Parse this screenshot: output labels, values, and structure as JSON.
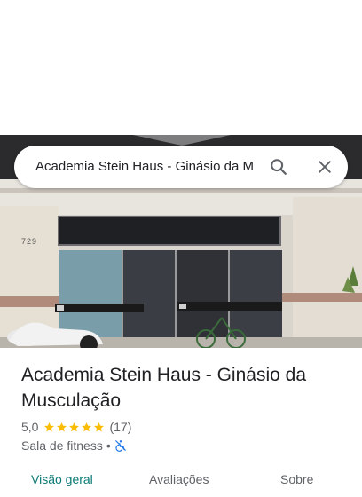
{
  "search": {
    "query": "Academia Stein Haus - Ginásio da M"
  },
  "photo": {
    "building_number": "729"
  },
  "place": {
    "title": "Academia Stein Haus - Ginásio da Musculação",
    "rating": "5,0",
    "star_count": 5,
    "review_count": "(17)",
    "category": "Sala de fitness",
    "separator": "•",
    "accessibility_icon": "wheelchair-not-accessible-icon"
  },
  "tabs": [
    {
      "label": "Visão geral",
      "selected": true
    },
    {
      "label": "Avaliações",
      "selected": false
    },
    {
      "label": "Sobre",
      "selected": false
    }
  ],
  "colors": {
    "star": "#fbbc04",
    "selected_tab": "#0b7a75",
    "accessibility_icon": "#1a73e8"
  }
}
